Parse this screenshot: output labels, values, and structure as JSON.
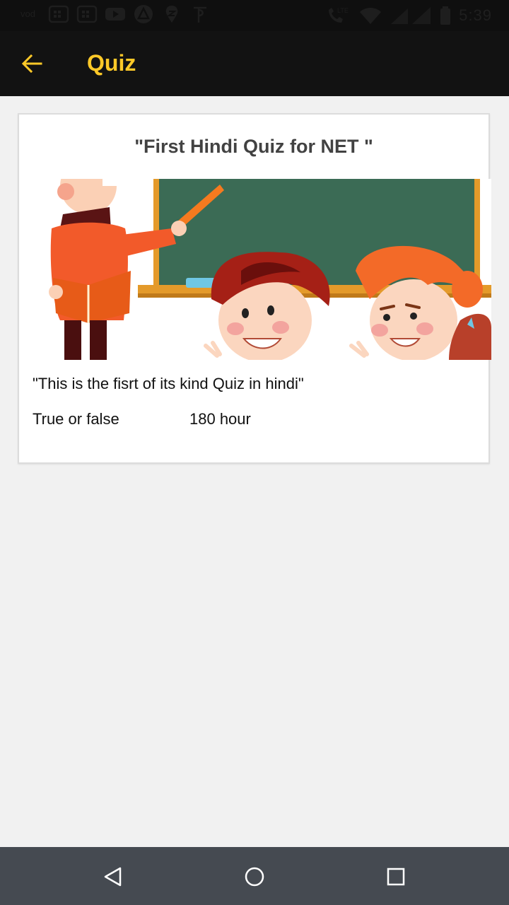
{
  "status_bar": {
    "time": "5:39",
    "lte_label": "LTE",
    "left_icons": [
      "sim-card-icon",
      "calendar-icon",
      "calendar-icon",
      "youtube-icon",
      "arrow-up-app-icon",
      "swiggy-icon",
      "phonepe-icon"
    ],
    "right_icons": [
      "call-lte-icon",
      "wifi-icon",
      "signal-icon",
      "battery-icon"
    ]
  },
  "app_bar": {
    "title": "Quiz",
    "back_icon": "arrow-back-icon",
    "accent_color": "#ffc928",
    "background": "#121212"
  },
  "card": {
    "title": "\"First Hindi Quiz for NET \"",
    "description": "\"This is the fisrt of its kind Quiz in hindi\"",
    "type": "True or false",
    "duration": "180 hour",
    "image_icon": "teacher-students-classroom-illustration"
  },
  "nav_bar": {
    "back_icon": "nav-back-icon",
    "home_icon": "nav-home-icon",
    "recents_icon": "nav-recents-icon",
    "background": "#454a51"
  }
}
